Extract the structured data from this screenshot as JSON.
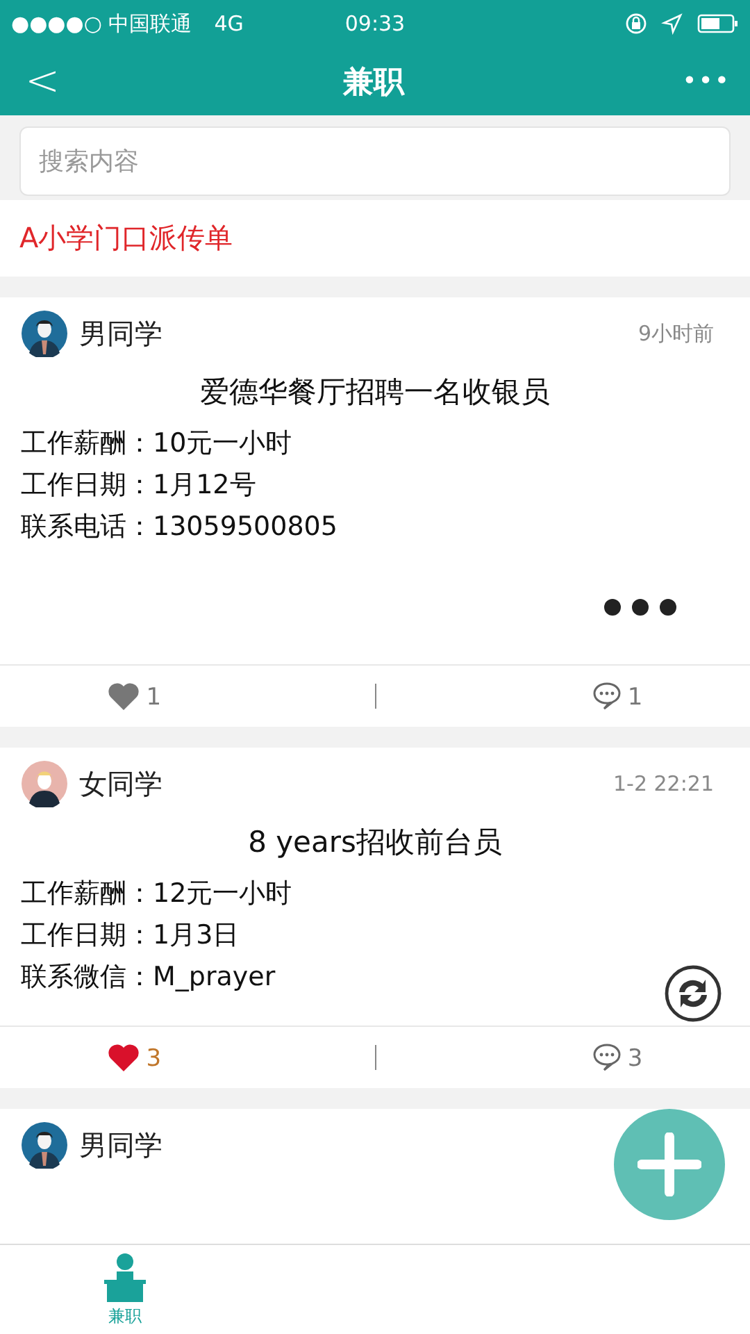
{
  "status_bar": {
    "carrier": "●●●●○ 中国联通",
    "network": "4G",
    "time": "09:33"
  },
  "nav": {
    "back": "<",
    "title": "兼职",
    "more": "•••"
  },
  "search": {
    "placeholder": "搜索内容"
  },
  "notice": "A小学门口派传单",
  "posts": [
    {
      "avatar": {
        "kind": "male"
      },
      "author": "男同学",
      "time": "9小时前",
      "title": "爱德华餐厅招聘一名收银员",
      "fields": [
        "工作薪酬：10元一小时",
        "工作日期：1月12号",
        "联系电话：13059500805"
      ],
      "kind": "more",
      "liked": false,
      "likes": "1",
      "comments": "1"
    },
    {
      "avatar": {
        "kind": "female"
      },
      "author": "女同学",
      "time": "1-2 22:21",
      "title": "8 years招收前台员",
      "fields": [
        "工作薪酬：12元一小时",
        "工作日期：1月3日",
        "联系微信：M_prayer"
      ],
      "kind": "refresh",
      "liked": true,
      "likes": "3",
      "comments": "3"
    },
    {
      "avatar": {
        "kind": "male"
      },
      "author": "男同学"
    }
  ],
  "tab_bar": [
    {
      "label": "兼职",
      "selected": true
    }
  ]
}
